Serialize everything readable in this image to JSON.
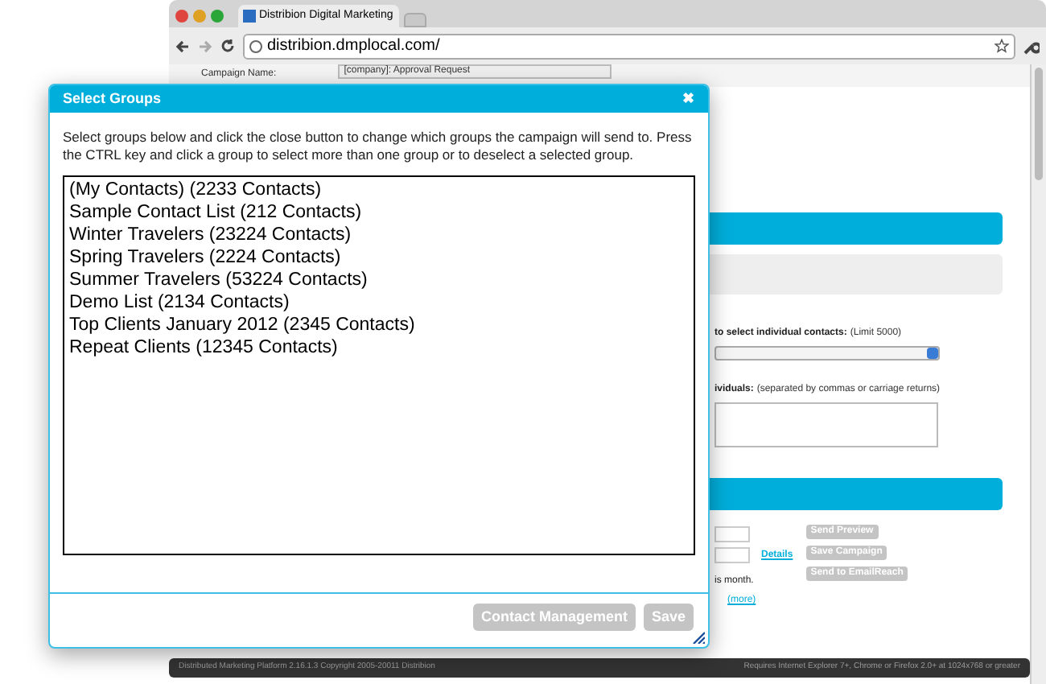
{
  "browser": {
    "tab_title": "Distribion Digital Marketing",
    "address": "distribion.dmplocal.com/"
  },
  "page": {
    "campaign_label": "Campaign Name:",
    "campaign_value": "[company]:  Approval Request",
    "contacts_label": "to select individual contacts:",
    "contacts_limit": "(Limit 5000)",
    "individuals_label": "ividuals:",
    "individuals_hint": "(separated by commas or carriage returns)",
    "details_link": "Details",
    "month_text": "is month.",
    "more_link": "(more)",
    "buttons": [
      "Send Preview",
      "Save Campaign",
      "Send to EmailReach"
    ],
    "footer_left": "Distributed Marketing Platform 2.16.1.3   Copyright 2005-20011 Distribion",
    "footer_right": "Requires Internet Explorer 7+, Chrome or Firefox 2.0+ at 1024x768 or greater"
  },
  "dialog": {
    "title": "Select Groups",
    "close": "✖",
    "instructions": "Select groups below and click the close button to change which groups the campaign will send to. Press the CTRL key and click a group to select more than one group or to deselect a selected group.",
    "groups": [
      {
        "label": "(My Contacts) (2233 Contacts)",
        "selected": false
      },
      {
        "label": "Sample Contact List (212 Contacts)",
        "selected": false
      },
      {
        "label": "Winter Travelers (23224 Contacts)",
        "selected": false
      },
      {
        "label": "Spring Travelers (2224 Contacts)",
        "selected": false
      },
      {
        "label": "Summer Travelers (53224 Contacts)",
        "selected": false
      },
      {
        "label": "Demo List (2134 Contacts)",
        "selected": false
      },
      {
        "label": "Top Clients January 2012 (2345 Contacts)",
        "selected": false
      },
      {
        "label": "Repeat Clients (12345 Contacts)",
        "selected": false
      }
    ],
    "buttons": [
      "Contact Management",
      "Save"
    ]
  }
}
